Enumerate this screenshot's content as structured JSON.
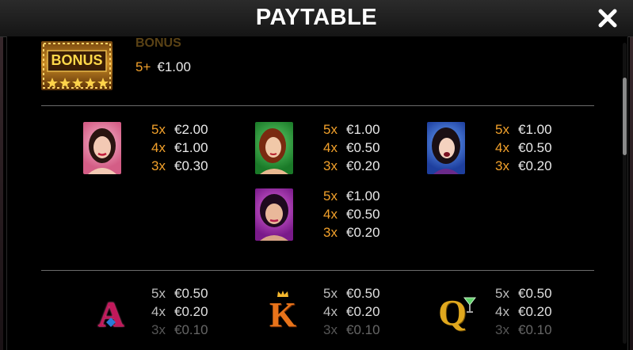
{
  "header": {
    "title": "PAYTABLE"
  },
  "bonus": {
    "label": "BONUS",
    "icon_text": "BONUS",
    "multiplier": "5+",
    "value": "€1.00"
  },
  "symbols": {
    "woman_pink": [
      {
        "m": "5x",
        "v": "€2.00"
      },
      {
        "m": "4x",
        "v": "€1.00"
      },
      {
        "m": "3x",
        "v": "€0.30"
      }
    ],
    "woman_green": [
      {
        "m": "5x",
        "v": "€1.00"
      },
      {
        "m": "4x",
        "v": "€0.50"
      },
      {
        "m": "3x",
        "v": "€0.20"
      }
    ],
    "woman_blue": [
      {
        "m": "5x",
        "v": "€1.00"
      },
      {
        "m": "4x",
        "v": "€0.50"
      },
      {
        "m": "3x",
        "v": "€0.20"
      }
    ],
    "woman_purple": [
      {
        "m": "5x",
        "v": "€1.00"
      },
      {
        "m": "4x",
        "v": "€0.50"
      },
      {
        "m": "3x",
        "v": "€0.20"
      }
    ],
    "card_a": {
      "letter": "A",
      "pays": [
        {
          "m": "5x",
          "v": "€0.50"
        },
        {
          "m": "4x",
          "v": "€0.20"
        },
        {
          "m": "3x",
          "v": "€0.10"
        }
      ]
    },
    "card_k": {
      "letter": "K",
      "pays": [
        {
          "m": "5x",
          "v": "€0.50"
        },
        {
          "m": "4x",
          "v": "€0.20"
        },
        {
          "m": "3x",
          "v": "€0.10"
        }
      ]
    },
    "card_q": {
      "letter": "Q",
      "pays": [
        {
          "m": "5x",
          "v": "€0.50"
        },
        {
          "m": "4x",
          "v": "€0.20"
        },
        {
          "m": "3x",
          "v": "€0.10"
        }
      ]
    }
  },
  "colors": {
    "multiplier": "#f2a12b",
    "value": "#eaeaea",
    "divider": "#6b6b6b",
    "header_bg": "#1f1f1f"
  }
}
